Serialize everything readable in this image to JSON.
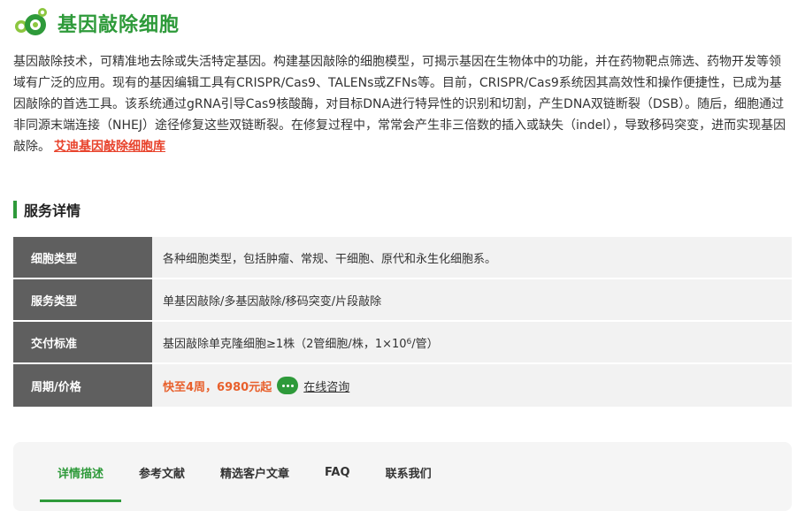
{
  "header": {
    "title": "基因敲除细胞",
    "logo_icon": "cells-logo-icon"
  },
  "intro": {
    "text": "基因敲除技术，可精准地去除或失活特定基因。构建基因敲除的细胞模型，可揭示基因在生物体中的功能，并在药物靶点筛选、药物开发等领域有广泛的应用。现有的基因编辑工具有CRISPR/Cas9、TALENs或ZFNs等。目前，CRISPR/Cas9系统因其高效性和操作便捷性，已成为基因敲除的首选工具。该系统通过gRNA引导Cas9核酸酶，对目标DNA进行特异性的识别和切割，产生DNA双链断裂（DSB）。随后，细胞通过非同源末端连接（NHEJ）途径修复这些双链断裂。在修复过程中，常常会产生非三倍数的插入或缺失（indel），导致移码突变，进而实现基因敲除。",
    "link_label": "艾迪基因敲除细胞库"
  },
  "section": {
    "title": "服务详情"
  },
  "details": {
    "rows": [
      {
        "label": "细胞类型",
        "value": "各种细胞类型，包括肿瘤、常规、干细胞、原代和永生化细胞系。"
      },
      {
        "label": "服务类型",
        "value": "单基因敲除/多基因敲除/移码突变/片段敲除"
      },
      {
        "label": "交付标准",
        "value_prefix": "基因敲除单克隆细胞≥1株（2管细胞/株，1×10",
        "value_sup": "6",
        "value_suffix": "/管）"
      },
      {
        "label": "周期/价格",
        "price": "快至4周，6980元起",
        "consult_label": "在线咨询",
        "consult_icon": "chat-bubble-icon"
      }
    ]
  },
  "tabs": {
    "items": [
      {
        "label": "详情描述",
        "active": true
      },
      {
        "label": "参考文献",
        "active": false
      },
      {
        "label": "精选客户文章",
        "active": false
      },
      {
        "label": "FAQ",
        "active": false
      },
      {
        "label": "联系我们",
        "active": false
      }
    ]
  },
  "colors": {
    "brand_green": "#2e9a3a",
    "link_red": "#e8432c",
    "price_orange": "#e8602c",
    "label_bg": "#5f5f5f",
    "value_bg": "#f2f2f2"
  }
}
